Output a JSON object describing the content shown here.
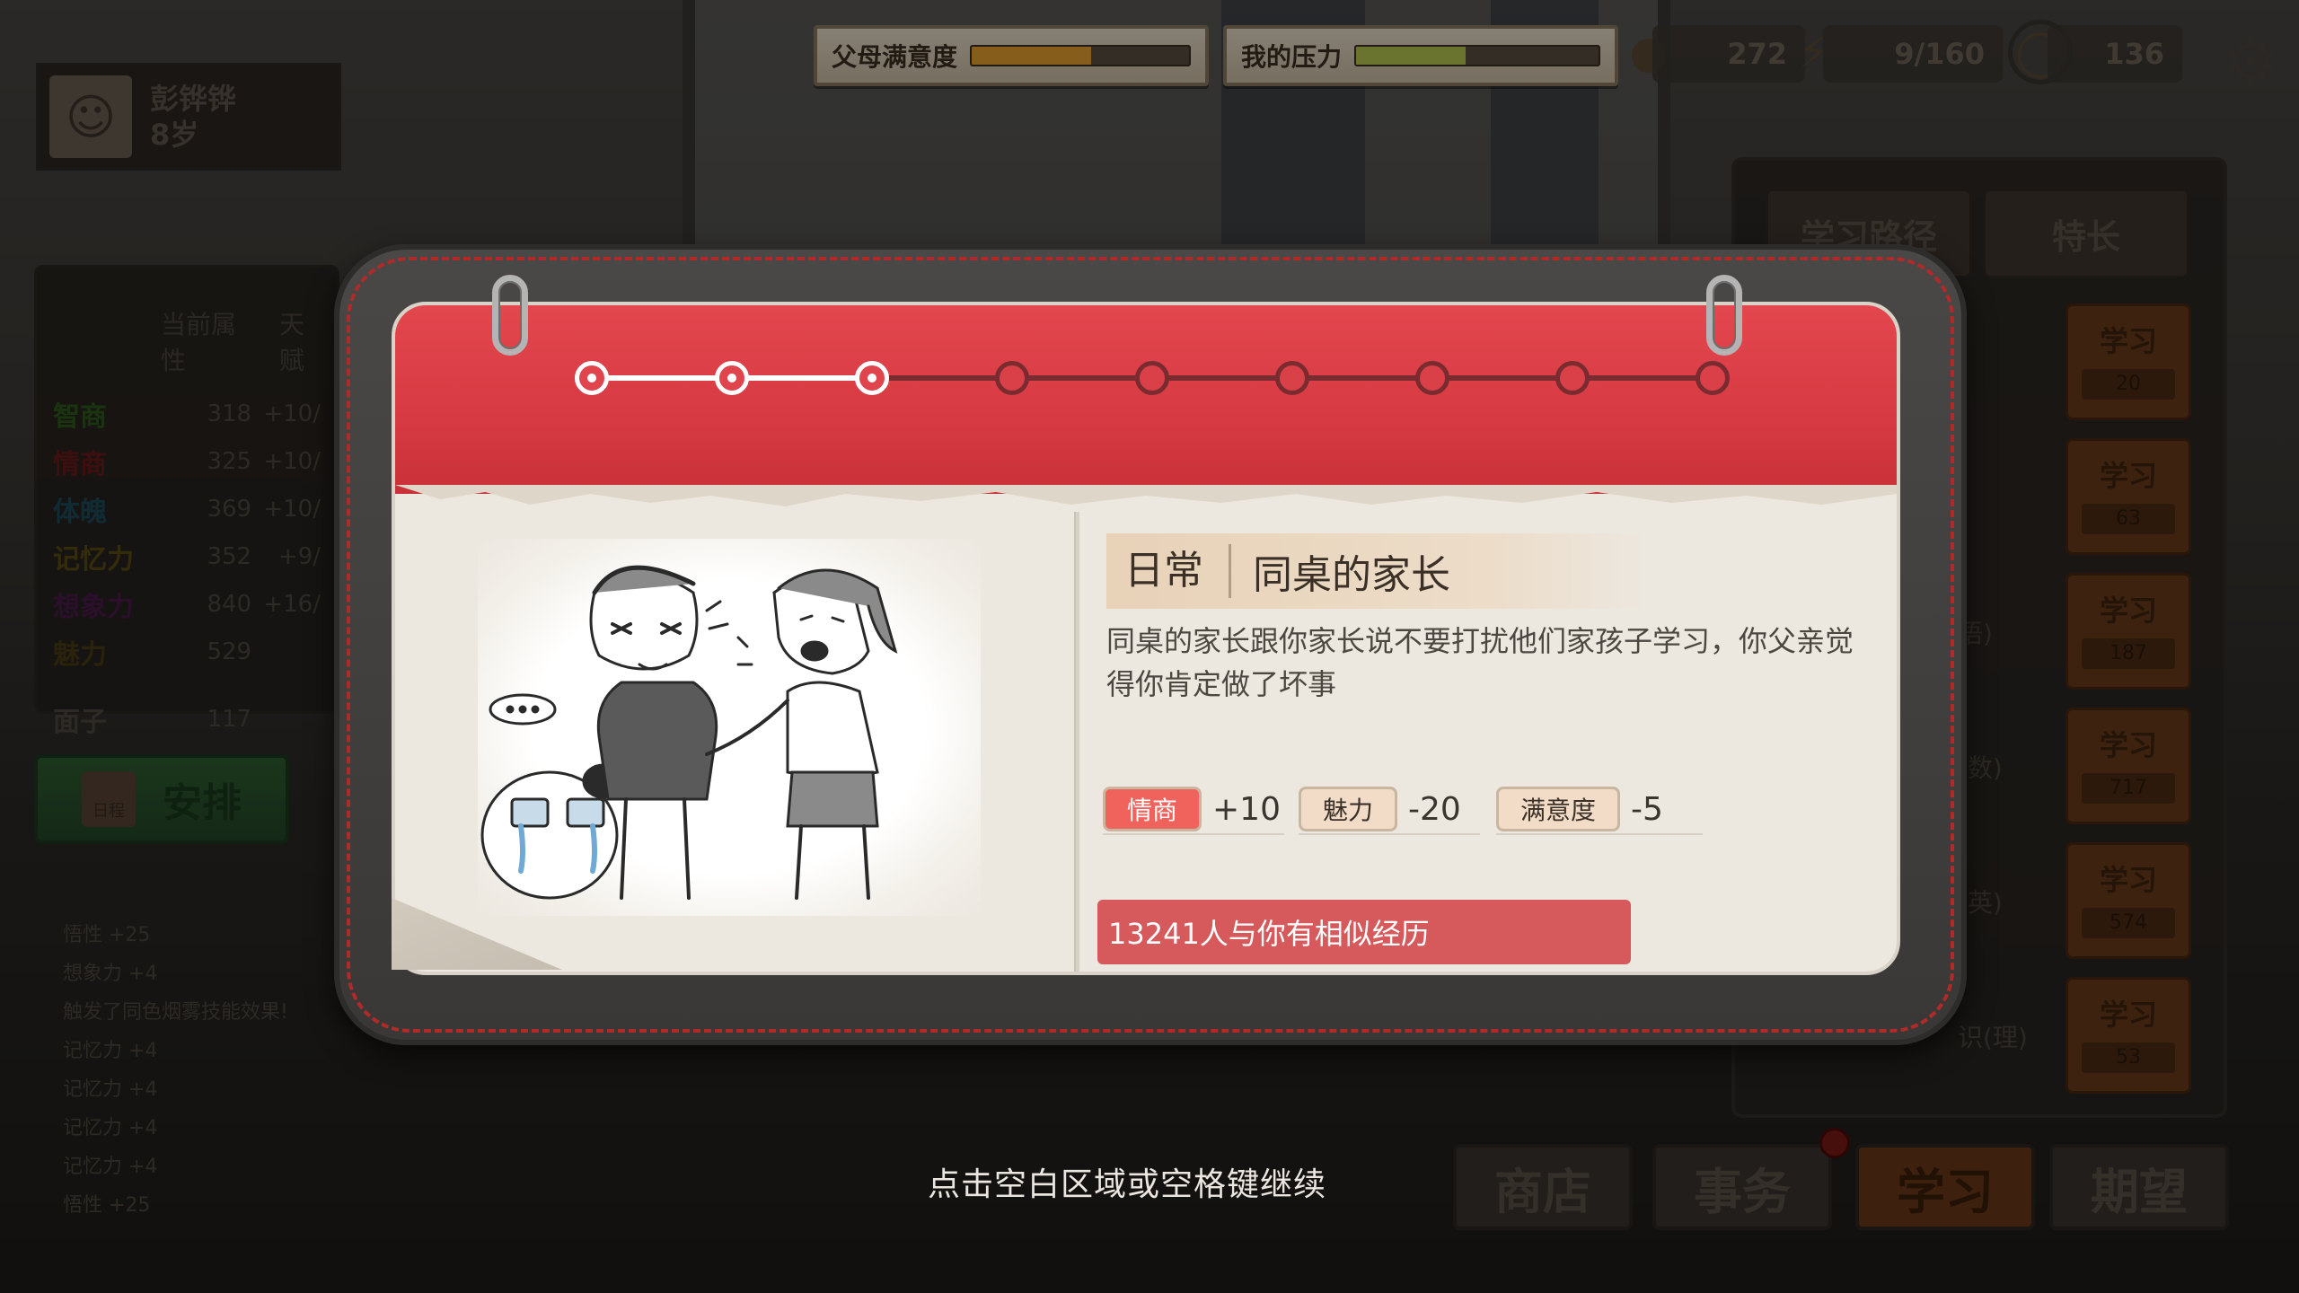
{
  "top_bar": {
    "parent_satisfaction_label": "父母满意度",
    "parent_satisfaction_level": 0.55,
    "stress_label": "我的压力",
    "stress_level": 0.45,
    "wisdom_value": "272",
    "energy_value": "9/160",
    "time_value": "136"
  },
  "character": {
    "name": "彭铧铧",
    "age": "8岁"
  },
  "attributes": {
    "header_current": "当前属性",
    "header_talent": "天赋",
    "rows": [
      {
        "name": "智商",
        "value": "318",
        "delta": "+10/",
        "color": "#2e5a1c"
      },
      {
        "name": "情商",
        "value": "325",
        "delta": "+10/",
        "color": "#6a1a1a"
      },
      {
        "name": "体魄",
        "value": "369",
        "delta": "+10/",
        "color": "#1c4a5a"
      },
      {
        "name": "记忆力",
        "value": "352",
        "delta": "+9/",
        "color": "#5a4a14"
      },
      {
        "name": "想象力",
        "value": "840",
        "delta": "+16/",
        "color": "#4a1a4a"
      },
      {
        "name": "魅力",
        "value": "529",
        "delta": "",
        "color": "#4a3c14"
      },
      {
        "name": "面子",
        "value": "117",
        "delta": "",
        "color": "#4e473e"
      }
    ]
  },
  "arrange": {
    "calendar_label": "日程",
    "button_label": "安排"
  },
  "log": {
    "entries": [
      "悟性 +25",
      "想象力 +4",
      "触发了同色烟雾技能效果!",
      "记忆力 +4",
      "记忆力 +4",
      "记忆力 +4",
      "记忆力 +4",
      "悟性 +25"
    ]
  },
  "study_panel": {
    "tab_path": "学习路径",
    "tab_talent": "特长",
    "learn_label": "学习",
    "costs": [
      "20",
      "63",
      "187",
      "717",
      "574",
      "53"
    ],
    "subjects": [
      "",
      "",
      "语)",
      "(数)",
      "(英)",
      "识(理)"
    ]
  },
  "bottom_nav": {
    "shop": "商店",
    "affairs": "事务",
    "study": "学习",
    "hope": "期望"
  },
  "continue_hint": "点击空白区域或空格键继续",
  "event": {
    "progress_total": 9,
    "progress_done": 3,
    "type": "日常",
    "title": "同桌的家长",
    "description": "同桌的家长跟你家长说不要打扰他们家孩子学习，你父亲觉得你肯定做了坏事",
    "effects": [
      {
        "label": "情商",
        "value": "+10",
        "bg": "#f0625c",
        "fg": "#ffffff"
      },
      {
        "label": "魅力",
        "value": "-20",
        "bg": "#f2dcc8",
        "fg": "#3b3027"
      },
      {
        "label": "满意度",
        "value": "-5",
        "bg": "#f2dcc8",
        "fg": "#3b3027"
      }
    ],
    "similar_text": "13241人与你有相似经历"
  },
  "colors": {
    "header_red": "#d73a42",
    "satisfaction_fill": "#e8a030",
    "stress_fill": "#b8c850"
  }
}
